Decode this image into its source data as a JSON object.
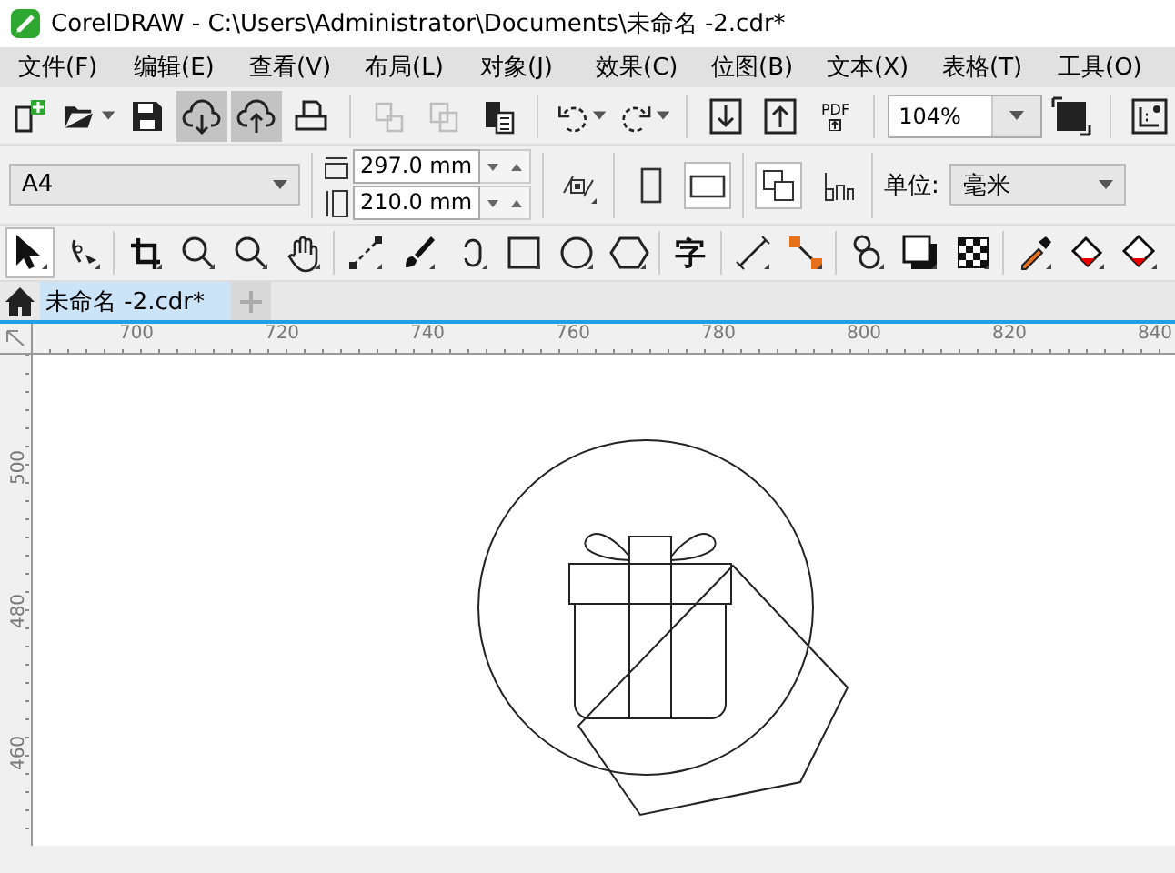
{
  "window": {
    "title": "CorelDRAW - C:\\Users\\Administrator\\Documents\\未命名 -2.cdr*"
  },
  "menu": [
    "文件(F)",
    "编辑(E)",
    "查看(V)",
    "布局(L)",
    "对象(J)",
    "效果(C)",
    "位图(B)",
    "文本(X)",
    "表格(T)",
    "工具(O)"
  ],
  "toolbar": {
    "buttons": [
      {
        "selected": false,
        "disabled": false
      },
      {
        "selected": false,
        "disabled": false
      },
      {
        "selected": false,
        "disabled": false
      },
      {
        "selected": true,
        "disabled": false
      },
      {
        "selected": true,
        "disabled": false
      },
      {
        "selected": false,
        "disabled": false
      },
      {
        "selected": false,
        "disabled": true
      },
      {
        "selected": false,
        "disabled": true
      },
      {
        "selected": false,
        "disabled": false
      },
      {
        "selected": false,
        "disabled": false
      },
      {
        "selected": false,
        "disabled": false
      },
      {
        "selected": false,
        "disabled": false
      },
      {
        "selected": false,
        "disabled": false
      },
      {
        "selected": false,
        "disabled": false,
        "label": "PDF"
      }
    ],
    "zoom": "104%"
  },
  "property_bar": {
    "page_size": "A4",
    "width": "297.0 mm",
    "height": "210.0 mm",
    "orientation": [
      {
        "selected": false
      },
      {
        "selected": true
      }
    ],
    "page_buttons": [
      {
        "selected": true
      },
      {
        "selected": false
      }
    ],
    "unit_label": "单位:",
    "unit": "毫米"
  },
  "toolbox": [
    {
      "selected": true
    },
    {
      "selected": false
    },
    {
      "selected": false
    },
    {
      "selected": false
    },
    {
      "selected": false
    },
    {
      "selected": false
    },
    {
      "selected": false
    },
    {
      "selected": false
    },
    {
      "selected": false
    },
    {
      "selected": false
    },
    {
      "selected": false
    },
    {
      "selected": false
    },
    {
      "selected": false,
      "glyph": "字"
    },
    {
      "selected": false
    },
    {
      "selected": false
    },
    {
      "selected": false
    },
    {
      "selected": false
    },
    {
      "selected": false
    },
    {
      "selected": false
    },
    {
      "selected": false
    },
    {
      "selected": false
    }
  ],
  "tabs": [
    {
      "label": "未命名 -2.cdr*",
      "selected": true
    }
  ],
  "rulers": {
    "horizontal": [
      "700",
      "720",
      "740",
      "760",
      "780",
      "800",
      "820",
      "840"
    ],
    "vertical": [
      "500",
      "480",
      "460"
    ]
  }
}
